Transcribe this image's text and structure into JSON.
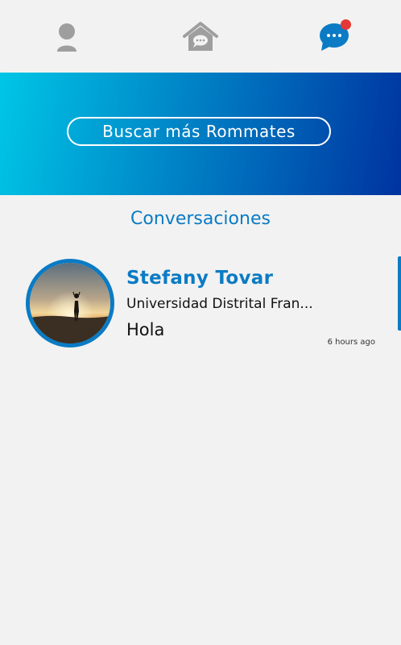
{
  "colors": {
    "accent": "#0a7bc4",
    "icon_gray": "#9e9e9e",
    "notification": "#e53935",
    "banner_start": "#00c6e6",
    "banner_end": "#0033a0"
  },
  "nav": {
    "items": [
      {
        "icon": "user-icon"
      },
      {
        "icon": "home-chat-icon"
      },
      {
        "icon": "chat-bubble-icon"
      }
    ]
  },
  "banner": {
    "search_label": "Buscar más Rommates"
  },
  "conversations": {
    "title": "Conversaciones",
    "items": [
      {
        "name": "Stefany Tovar",
        "university": "Universidad Distrital Fran...",
        "last_message": "Hola",
        "time": "6 hours ago"
      }
    ]
  }
}
